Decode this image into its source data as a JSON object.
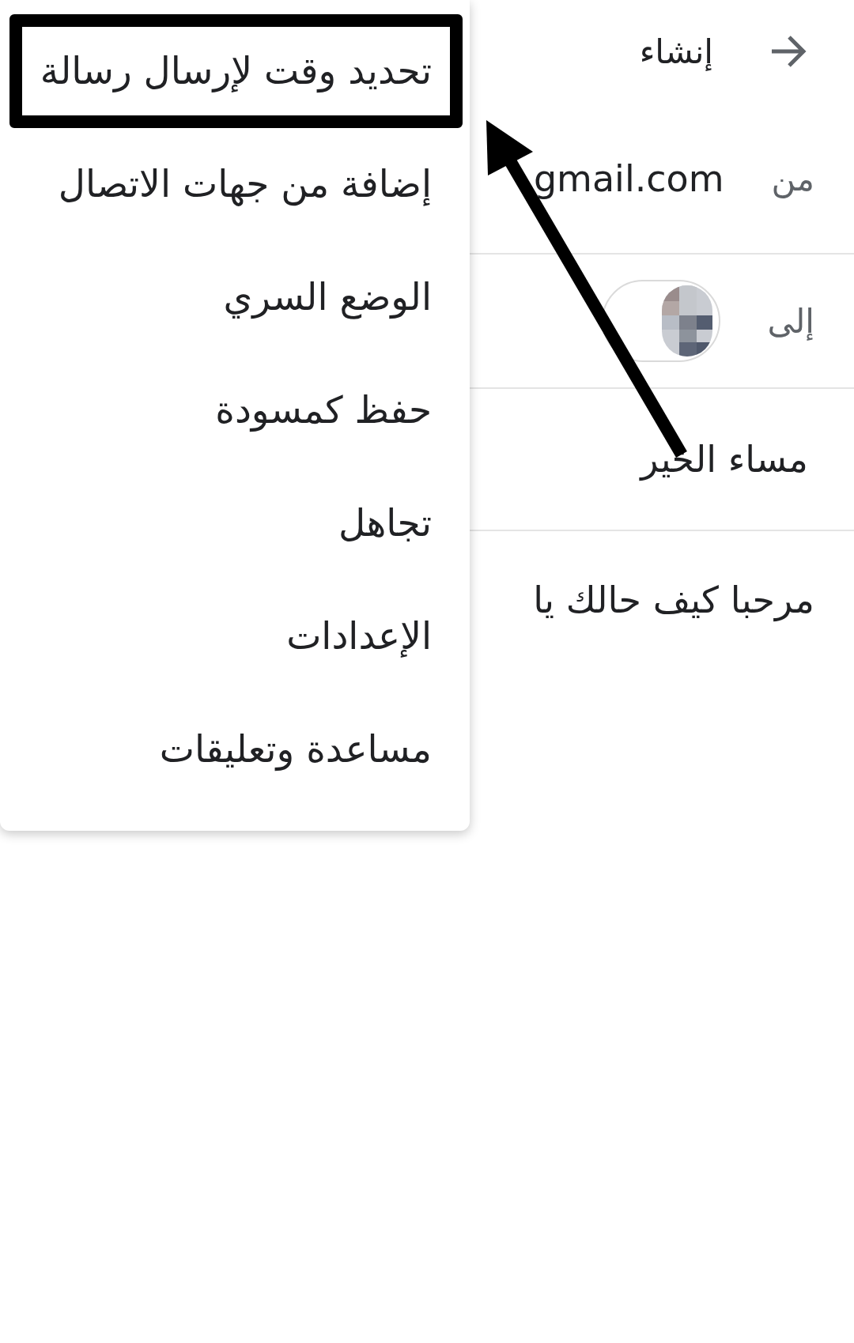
{
  "header": {
    "title": "إنشاء"
  },
  "from": {
    "label": "من",
    "value": "gmail.com"
  },
  "to": {
    "label": "إلى"
  },
  "subject": {
    "value": "مساء الخير"
  },
  "body": {
    "value": "مرحبا كيف حالك يا"
  },
  "menu": {
    "items": [
      {
        "label": "تحديد وقت لإرسال رسالة",
        "highlighted": true
      },
      {
        "label": "إضافة من جهات الاتصال",
        "highlighted": false
      },
      {
        "label": "الوضع السري",
        "highlighted": false
      },
      {
        "label": "حفظ كمسودة",
        "highlighted": false
      },
      {
        "label": "تجاهل",
        "highlighted": false
      },
      {
        "label": "الإعدادات",
        "highlighted": false
      },
      {
        "label": "مساعدة وتعليقات",
        "highlighted": false
      }
    ]
  }
}
